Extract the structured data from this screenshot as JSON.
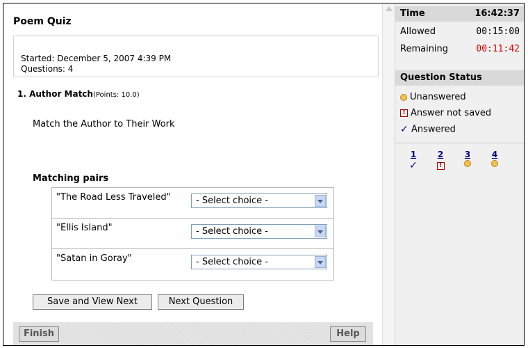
{
  "quiz": {
    "title": "Poem Quiz",
    "started": "Started: December 5, 2007 4:39 PM",
    "questions": "Questions: 4"
  },
  "question": {
    "number_title": "1. Author Match",
    "points": "(Points: 10.0)",
    "text": "Match the Author to Their Work",
    "pairs_label": "Matching pairs",
    "pairs": [
      {
        "prompt": "\"The Road Less Traveled\"",
        "selected": "- Select choice -"
      },
      {
        "prompt": "\"Ellis Island\"",
        "selected": "- Select choice -"
      },
      {
        "prompt": "\"Satan in Goray\"",
        "selected": "- Select choice -"
      }
    ]
  },
  "buttons": {
    "save_next": "Save and View Next",
    "next_question": "Next Question",
    "finish": "Finish",
    "help": "Help"
  },
  "timer": {
    "label": "Time",
    "current": "16:42:37",
    "allowed_label": "Allowed",
    "allowed": "00:15:00",
    "remaining_label": "Remaining",
    "remaining": "00:11:42",
    "remaining_color": "#e00000"
  },
  "status": {
    "title": "Question Status",
    "legend": [
      {
        "icon": "circle-icon",
        "label": "Unanswered"
      },
      {
        "icon": "exclamation-box-icon",
        "label": "Answer not saved"
      },
      {
        "icon": "checkmark-icon",
        "label": "Answered"
      }
    ],
    "questions": [
      {
        "num": "1",
        "state": "answered"
      },
      {
        "num": "2",
        "state": "not-saved"
      },
      {
        "num": "3",
        "state": "unanswered"
      },
      {
        "num": "4",
        "state": "unanswered"
      }
    ]
  }
}
